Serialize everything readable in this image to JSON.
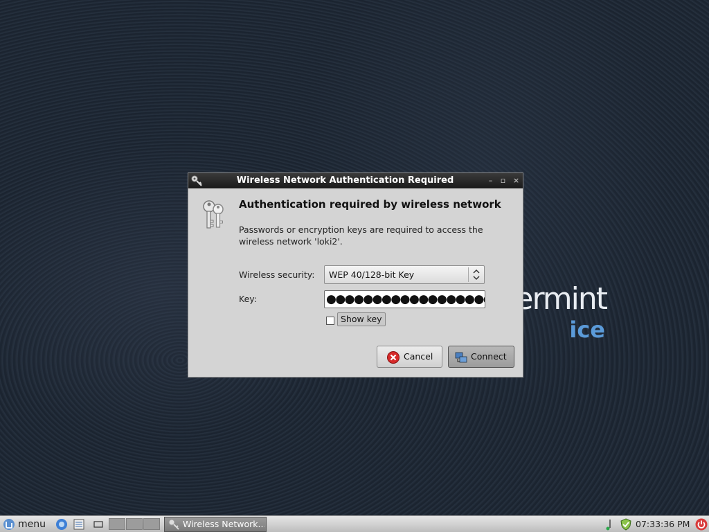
{
  "dialog": {
    "title": "Wireless Network Authentication Required",
    "heading": "Authentication required by wireless network",
    "description": "Passwords or encryption keys are required to access the wireless network 'loki2'.",
    "security_label": "Wireless security:",
    "security_value": "WEP 40/128-bit Key",
    "key_label": "Key:",
    "key_value": "●●●●●●●●●●●●●●●●●●●●",
    "show_key_label": "Show key",
    "show_key_checked": false,
    "cancel_label": "Cancel",
    "connect_label": "Connect",
    "wm_minimize": "–",
    "wm_maximize": "▫",
    "wm_close": "×"
  },
  "wallpaper": {
    "logo_text": "ermint",
    "logo_sub": "ice"
  },
  "taskbar": {
    "menu_label": "menu",
    "task_window_label": "Wireless Network...",
    "clock": "07:33:36 PM"
  },
  "colors": {
    "desktop_bg": "#1d2633",
    "dialog_bg": "#d4d4d4",
    "titlebar_bg": "#222222",
    "cancel_icon_red": "#d62a2a",
    "power_icon_red": "#d93a3a",
    "logo_blue": "#5b9bd9"
  },
  "icons": {
    "title_icon": "key-icon",
    "dialog_icon": "keys-icon",
    "cancel_icon": "cancel-icon",
    "connect_icon": "network-icon",
    "menu_icon": "mint-logo-icon",
    "power_icon": "power-icon"
  }
}
